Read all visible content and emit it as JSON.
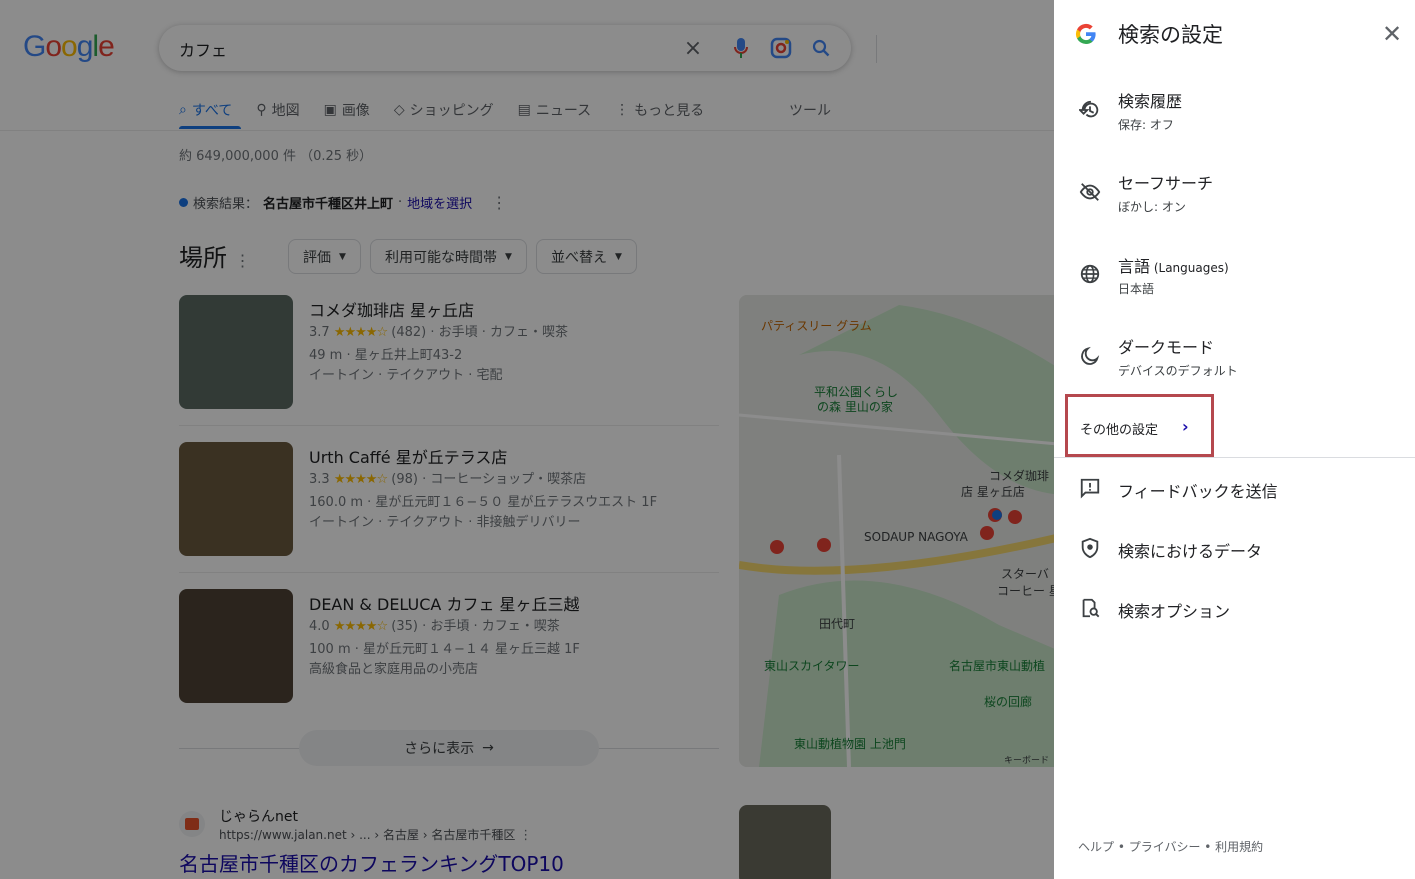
{
  "search": {
    "query": "カフェ",
    "tabs": [
      {
        "label": "すべて",
        "icon": "search-icon"
      },
      {
        "label": "地図",
        "icon": "pin-icon"
      },
      {
        "label": "画像",
        "icon": "image-icon"
      },
      {
        "label": "ショッピング",
        "icon": "tag-icon"
      },
      {
        "label": "ニュース",
        "icon": "news-icon"
      },
      {
        "label": "もっと見る",
        "icon": "more-vert-icon"
      }
    ],
    "tools_label": "ツール",
    "stats": "約 649,000,000 件 （0.25 秒）",
    "location_prefix": "検索結果：",
    "location_name": "名古屋市千種区井上町",
    "location_sep": " · ",
    "location_link": "地域を選択"
  },
  "places": {
    "heading": "場所",
    "filters": [
      "評価",
      "利用可能な時間帯",
      "並べ替え"
    ],
    "items": [
      {
        "name": "コメダ珈琲店 星ヶ丘店",
        "rating": "3.7",
        "stars": "★★★★☆",
        "reviews": "(482)",
        "meta": "· お手頃 · カフェ・喫茶",
        "address": "49 m · 星ヶ丘井上町43-2",
        "services": "イートイン · テイクアウト · 宅配",
        "thumb_color": "#5b6b63"
      },
      {
        "name": "Urth Caffé 星が丘テラス店",
        "rating": "3.3",
        "stars": "★★★★☆",
        "reviews": "(98)",
        "meta": "· コーヒーショップ・喫茶店",
        "address": "160.0 m · 星が丘元町１６−５０ 星が丘テラスウエスト 1F",
        "services": "イートイン · テイクアウト · 非接触デリバリー",
        "thumb_color": "#6a5a3e"
      },
      {
        "name": "DEAN & DELUCA カフェ 星ヶ丘三越",
        "rating": "4.0",
        "stars": "★★★★☆",
        "reviews": "(35)",
        "meta": "· お手頃 · カフェ・喫茶",
        "address": "100 m · 星が丘元町１４−１４ 星ヶ丘三越 1F",
        "services": "高級食品と家庭用品の小売店",
        "thumb_color": "#4f4336"
      }
    ],
    "more_label": "さらに表示"
  },
  "map": {
    "labels": [
      "パティスリー グラム",
      "平和公園くらし",
      "の森 里山の家",
      "コメダ珈琲",
      "店 星ヶ丘店",
      "SODAUP NAGOYA",
      "スターバ",
      "コーヒー 星",
      "田代町",
      "東山スカイタワー",
      "名古屋市東山動植",
      "東山動植物園 上池門",
      "桜の回廊",
      "キーボード"
    ]
  },
  "result": {
    "site_name": "じゃらんnet",
    "url": "https://www.jalan.net › ... › 名古屋 › 名古屋市千種区",
    "title": "名古屋市千種区のカフェランキングTOP10"
  },
  "panel": {
    "title": "検索の設定",
    "items": [
      {
        "label": "検索履歴",
        "sub": "保存: オフ",
        "icon": "history-icon"
      },
      {
        "label": "セーフサーチ",
        "sub": "ぼかし: オン",
        "icon": "eye-off-icon"
      },
      {
        "label": "言語",
        "label_suffix": " (Languages)",
        "sub": "日本語",
        "icon": "globe-icon"
      },
      {
        "label": "ダークモード",
        "sub": "デバイスのデフォルト",
        "icon": "moon-icon"
      }
    ],
    "other_settings": "その他の設定",
    "links": [
      {
        "label": "フィードバックを送信",
        "icon": "feedback-icon"
      },
      {
        "label": "検索におけるデータ",
        "icon": "shield-icon"
      },
      {
        "label": "検索オプション",
        "icon": "search-options-icon"
      }
    ],
    "footer": "ヘルプ • プライバシー • 利用規約"
  },
  "colors": {
    "accent": "#1a73e8",
    "highlight_border": "#b5484e",
    "link": "#1a0dab"
  }
}
